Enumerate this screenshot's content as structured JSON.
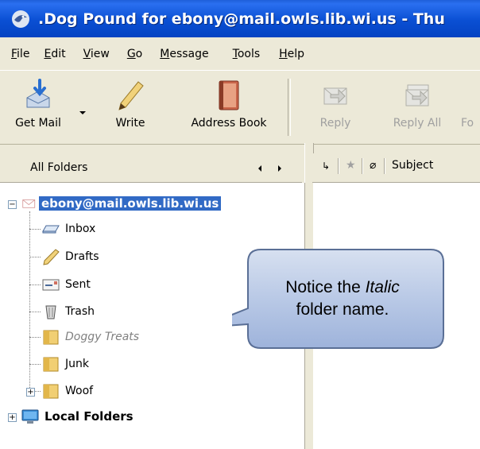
{
  "window": {
    "title": ".Dog Pound for ebony@mail.owls.lib.wi.us - Thu"
  },
  "menu": [
    {
      "label": "File",
      "key": "F",
      "rest": "ile"
    },
    {
      "label": "Edit",
      "key": "E",
      "rest": "dit"
    },
    {
      "label": "View",
      "key": "V",
      "rest": "iew"
    },
    {
      "label": "Go",
      "key": "G",
      "rest": "o"
    },
    {
      "label": "Message",
      "key": "M",
      "rest": "essage"
    },
    {
      "label": "Tools",
      "key": "T",
      "rest": "ools"
    },
    {
      "label": "Help",
      "key": "H",
      "rest": "elp"
    }
  ],
  "toolbar": {
    "get_mail": "Get Mail",
    "write": "Write",
    "address_book": "Address Book",
    "reply": "Reply",
    "reply_all": "Reply All",
    "forward": "Fo"
  },
  "folder_pane": {
    "header": "All Folders",
    "account": "ebony@mail.owls.lib.wi.us",
    "folders": [
      "Inbox",
      "Drafts",
      "Sent",
      "Trash",
      "Doggy Treats",
      "Junk",
      "Woof"
    ],
    "local_folders": "Local Folders"
  },
  "thread_pane": {
    "subject_header": "Subject"
  },
  "callout": {
    "line1_prefix": "Notice the ",
    "line1_italic": "Italic",
    "line2": "folder name."
  },
  "colors": {
    "selection": "#316ac5",
    "titlebar": "#0a4fd3"
  }
}
